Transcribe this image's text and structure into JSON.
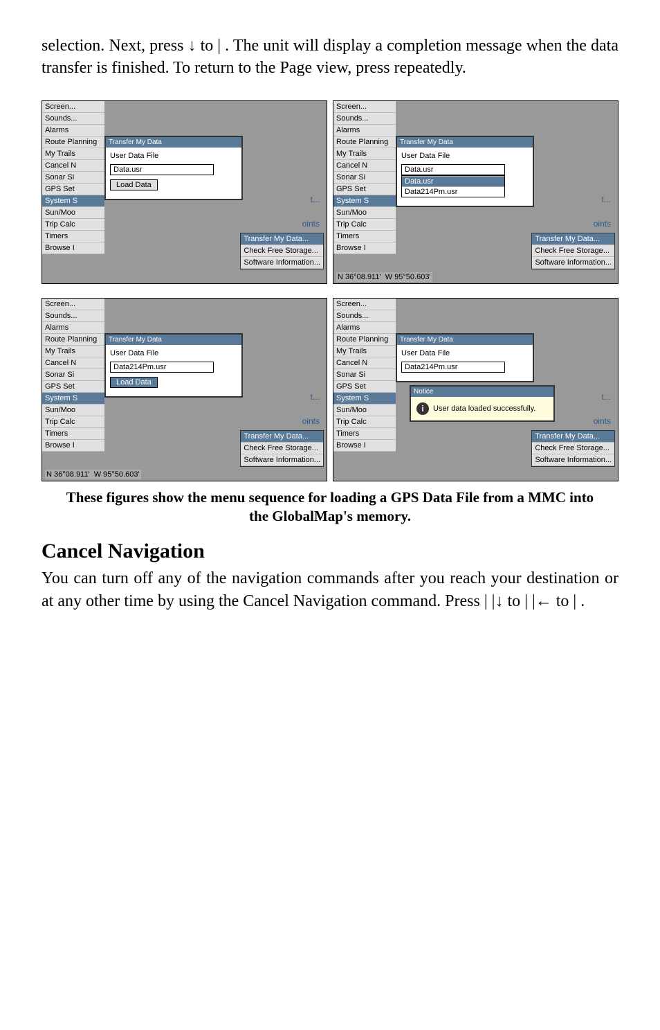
{
  "para1": "selection. Next, press ↓ to |  . The unit will display a completion message when the data transfer is finished. To return to the Page view, press   repeatedly.",
  "menu": {
    "items": [
      "Screen...",
      "Sounds...",
      "Alarms",
      "Route Planning",
      "My Trails",
      "Cancel N",
      "Sonar Si",
      "GPS Set",
      "System S",
      "Sun/Moo",
      "Trip Calc",
      "Timers",
      "Browse I"
    ],
    "highlight_index": 8
  },
  "dialog": {
    "title": "Transfer My Data",
    "row1_label": "User Data File",
    "input_a": "Data.usr",
    "input_b": "Data214Pm.usr",
    "button_load": "Load Data",
    "dropdown_items": [
      "Data.usr",
      "Data214Pm.usr"
    ]
  },
  "side_menu": {
    "items": [
      "Transfer My Data...",
      "Check Free Storage...",
      "Software Information..."
    ]
  },
  "right_labels": {
    "t": "t...",
    "oints": "oints"
  },
  "coords": {
    "lat": "36°08.911'",
    "lon": "95°50.603'",
    "n": "N",
    "w": "W"
  },
  "notice": {
    "title": "Notice",
    "body": "User data loaded successfully."
  },
  "caption": "These figures show the menu sequence for loading a GPS Data File from a MMC into the GlobalMap's memory.",
  "heading": "Cancel Navigation",
  "para2": "You can turn off any of the navigation commands after you reach your destination or at any other time by using the Cancel Navigation command. Press   |   |↓ to   |   |← to   |   ."
}
